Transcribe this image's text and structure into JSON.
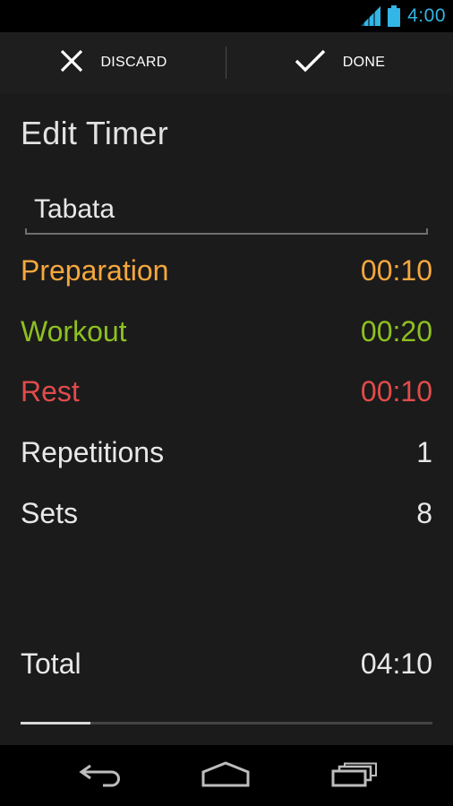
{
  "status_bar": {
    "time": "4:00"
  },
  "action_bar": {
    "discard_label": "DISCARD",
    "done_label": "DONE"
  },
  "page": {
    "title": "Edit Timer"
  },
  "timer_name": {
    "value": "Tabata"
  },
  "settings": [
    {
      "label": "Preparation",
      "value": "00:10",
      "color": "#f5a73e"
    },
    {
      "label": "Workout",
      "value": "00:20",
      "color": "#8ec021"
    },
    {
      "label": "Rest",
      "value": "00:10",
      "color": "#e24b4b"
    },
    {
      "label": "Repetitions",
      "value": "1",
      "color": "#e8e8e8"
    },
    {
      "label": "Sets",
      "value": "8",
      "color": "#e8e8e8"
    }
  ],
  "total": {
    "label": "Total",
    "value": "04:10"
  },
  "progress": {
    "fraction": 0.17
  },
  "colors": {
    "accent": "#33b5e5",
    "background": "#1b1b1b"
  },
  "icons": {
    "discard": "close-icon",
    "done": "checkmark-icon",
    "back": "back-icon",
    "home": "home-icon",
    "recents": "recent-apps-icon"
  }
}
